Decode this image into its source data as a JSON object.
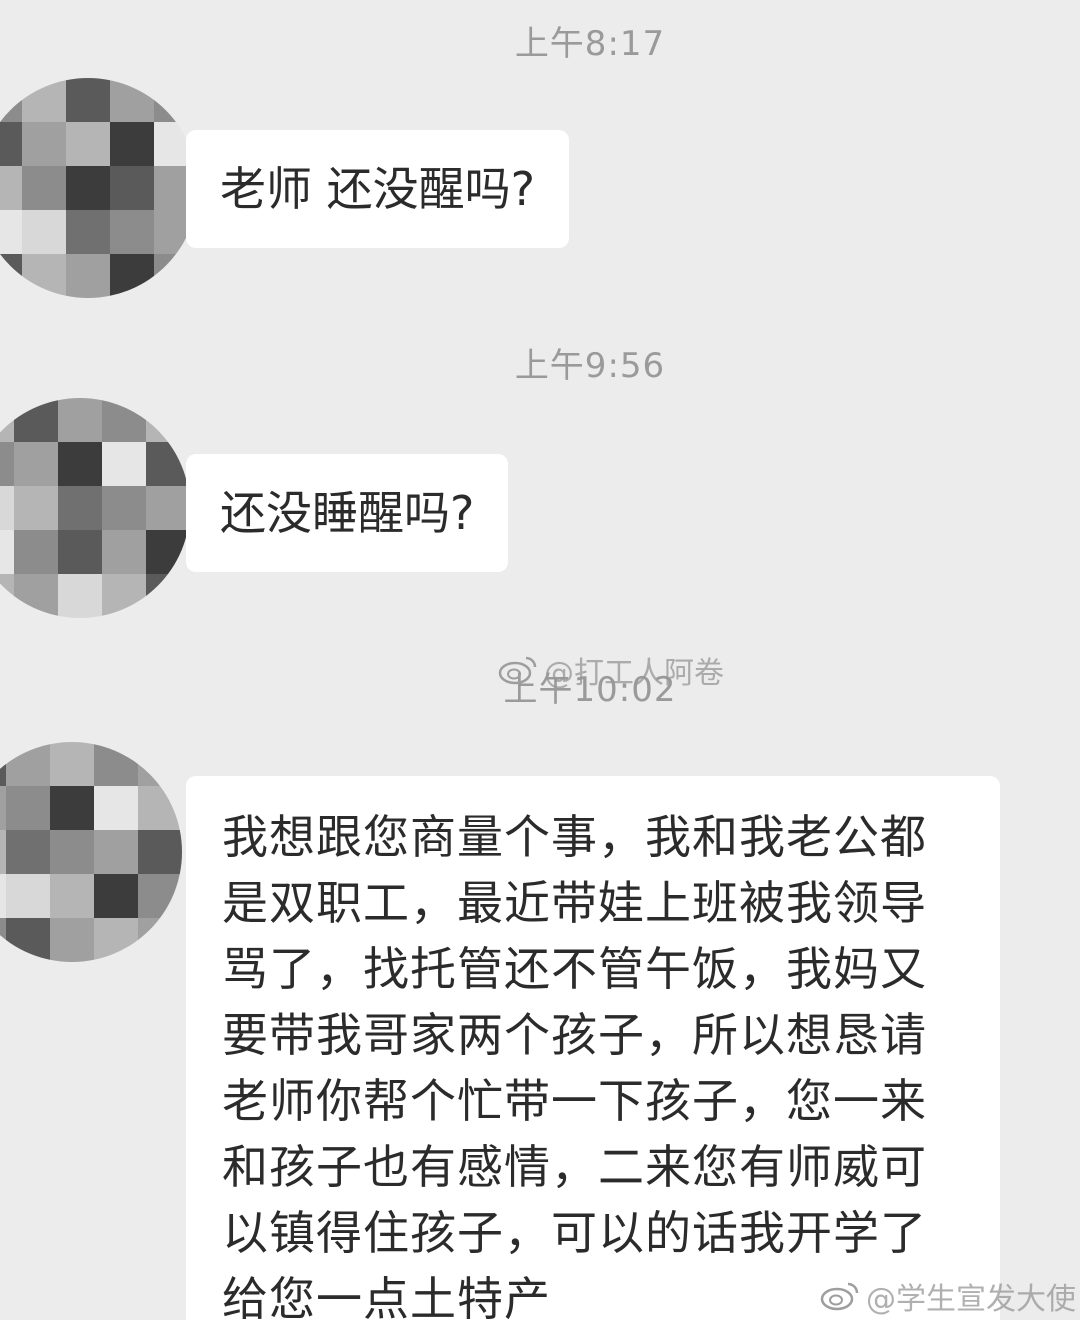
{
  "messages": [
    {
      "time": "上午8:17",
      "text": "老师 还没醒吗?"
    },
    {
      "time": "上午9:56",
      "text": "还没睡醒吗?"
    },
    {
      "time": "上午10:02",
      "lines": [
        "我想跟您商量个事，我和我老公都",
        "是双职工，最近带娃上班被我领导",
        "骂了，找托管还不管午饭，我妈又",
        "要带我哥家两个孩子，所以想恳请",
        "老师你帮个忙带一下孩子，您一来",
        "和孩子也有感情，二来您有师威可",
        "以镇得住孩子，可以的话我开学了",
        "给您一点土特产"
      ]
    }
  ],
  "watermarks": {
    "middle": "@打工人阿卷",
    "corner": "@学生宣发大使"
  },
  "avatar_palette": [
    "#5a5a5a",
    "#8c8c8c",
    "#b5b5b5",
    "#3c3c3c",
    "#d8d8d8",
    "#a0a0a0",
    "#707070",
    "#e6e6e6"
  ]
}
